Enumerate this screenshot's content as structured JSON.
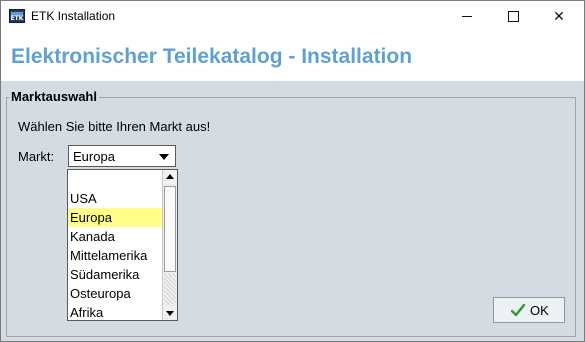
{
  "window": {
    "title": "ETK Installation",
    "icon_text": "ETK",
    "controls": {
      "minimize": "minimize",
      "maximize": "maximize",
      "close": "✕"
    }
  },
  "header": {
    "title": "Elektronischer Teilekatalog - Installation",
    "title_color": "#5fa2d1"
  },
  "group": {
    "legend": "Marktauswahl",
    "prompt": "Wählen Sie bitte Ihren Markt aus!",
    "market_label": "Markt:",
    "selected_market": "Europa",
    "dropdown_options": [
      "",
      "USA",
      "Europa",
      "Kanada",
      "Mittelamerika",
      "Südamerika",
      "Osteuropa",
      "Afrika"
    ],
    "highlighted_index": 2,
    "highlight_color": "#ffff8a"
  },
  "buttons": {
    "ok_label": "OK",
    "ok_icon": "check-icon",
    "ok_icon_color": "#2e9b2e"
  }
}
